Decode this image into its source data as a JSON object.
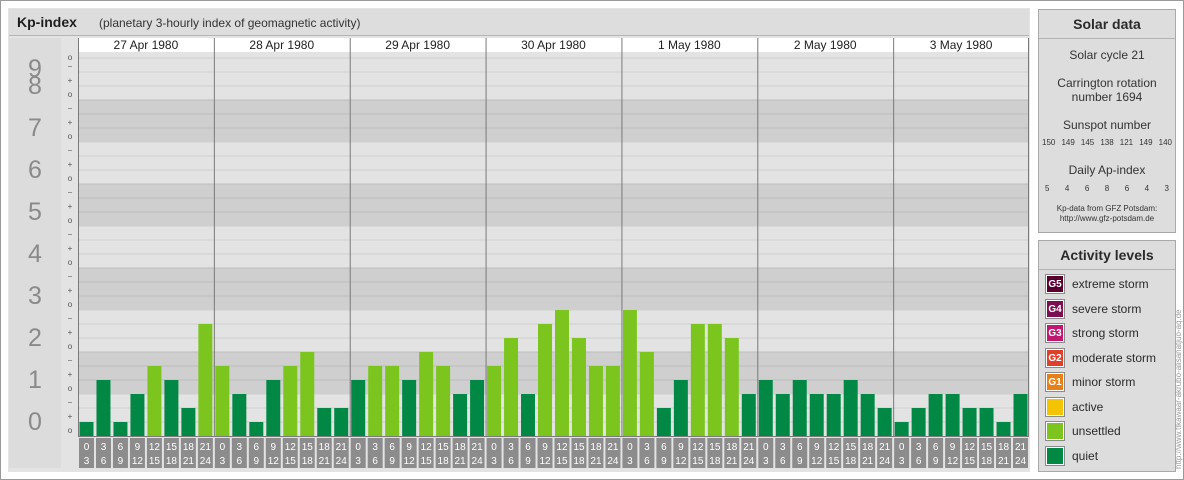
{
  "header": {
    "title": "Kp-index",
    "subtitle": "(planetary 3-hourly index of geomagnetic activity)"
  },
  "chart_data": {
    "type": "bar",
    "title": "Kp-index",
    "subtitle": "(planetary 3-hourly index of geomagnetic activity)",
    "xlabel": "",
    "ylabel": "",
    "ylim": [
      0,
      9
    ],
    "y_major_ticks": [
      "0",
      "1",
      "2",
      "3",
      "4",
      "5",
      "6",
      "7",
      "8",
      "9"
    ],
    "y_minor_ticks": [
      "o",
      "+",
      "−"
    ],
    "days": [
      "27 Apr 1980",
      "28 Apr 1980",
      "29 Apr 1980",
      "30 Apr 1980",
      "1 May 1980",
      "2 May 1980",
      "3 May 1980"
    ],
    "interval_labels": [
      [
        "0",
        "3"
      ],
      [
        "3",
        "6"
      ],
      [
        "6",
        "9"
      ],
      [
        "9",
        "12"
      ],
      [
        "12",
        "15"
      ],
      [
        "15",
        "18"
      ],
      [
        "18",
        "21"
      ],
      [
        "21",
        "24"
      ]
    ],
    "values": [
      [
        0.333,
        1.333,
        0.333,
        1.0,
        1.667,
        1.333,
        0.667,
        2.667
      ],
      [
        1.667,
        1.0,
        0.333,
        1.333,
        1.667,
        2.0,
        0.667,
        0.667
      ],
      [
        1.333,
        1.667,
        1.667,
        1.333,
        2.0,
        1.667,
        1.0,
        1.333
      ],
      [
        1.667,
        2.333,
        1.0,
        2.667,
        3.0,
        2.333,
        1.667,
        1.667
      ],
      [
        3.0,
        2.0,
        0.667,
        1.333,
        2.667,
        2.667,
        2.333,
        1.0
      ],
      [
        1.333,
        1.0,
        1.333,
        1.0,
        1.0,
        1.333,
        1.0,
        0.667
      ],
      [
        0.333,
        0.667,
        1.0,
        1.0,
        0.667,
        0.667,
        0.333,
        1.0
      ]
    ],
    "levels": [
      [
        0,
        0,
        0,
        0,
        1,
        0,
        0,
        1
      ],
      [
        1,
        0,
        0,
        0,
        1,
        1,
        0,
        0
      ],
      [
        0,
        1,
        1,
        0,
        1,
        1,
        0,
        0
      ],
      [
        1,
        1,
        0,
        1,
        1,
        1,
        1,
        1
      ],
      [
        1,
        1,
        0,
        0,
        1,
        1,
        1,
        0
      ],
      [
        0,
        0,
        0,
        0,
        0,
        0,
        0,
        0
      ],
      [
        0,
        0,
        0,
        0,
        0,
        0,
        0,
        0
      ]
    ],
    "level_colors": [
      "#008844",
      "#7cc51f"
    ],
    "legend_position": "right"
  },
  "solar": {
    "title": "Solar data",
    "cycle": "Solar cycle 21",
    "carrington": "Carrington rotation number 1694",
    "sunspot_title": "Sunspot number",
    "sunspot_values": [
      "150",
      "149",
      "145",
      "138",
      "121",
      "149",
      "140"
    ],
    "ap_title": "Daily Ap-index",
    "ap_values": [
      "5",
      "4",
      "6",
      "8",
      "6",
      "4",
      "3"
    ],
    "credit_line1": "Kp-data from GFZ Potsdam:",
    "credit_line2": "http://www.gfz-potsdam.de"
  },
  "activity": {
    "title": "Activity levels",
    "items": [
      {
        "code": "G5",
        "label": "extreme storm",
        "color": "#5a0030"
      },
      {
        "code": "G4",
        "label": "severe storm",
        "color": "#7a1050"
      },
      {
        "code": "G3",
        "label": "strong storm",
        "color": "#c01870"
      },
      {
        "code": "G2",
        "label": "moderate storm",
        "color": "#e0402a"
      },
      {
        "code": "G1",
        "label": "minor storm",
        "color": "#e88018"
      },
      {
        "code": "",
        "label": "active",
        "color": "#f5c400"
      },
      {
        "code": "",
        "label": "unsettled",
        "color": "#7cc51f"
      },
      {
        "code": "",
        "label": "quiet",
        "color": "#008844"
      }
    ]
  },
  "watermark": "http://www.tlkawaar-akrubo-alisanatjuo-aq.de"
}
